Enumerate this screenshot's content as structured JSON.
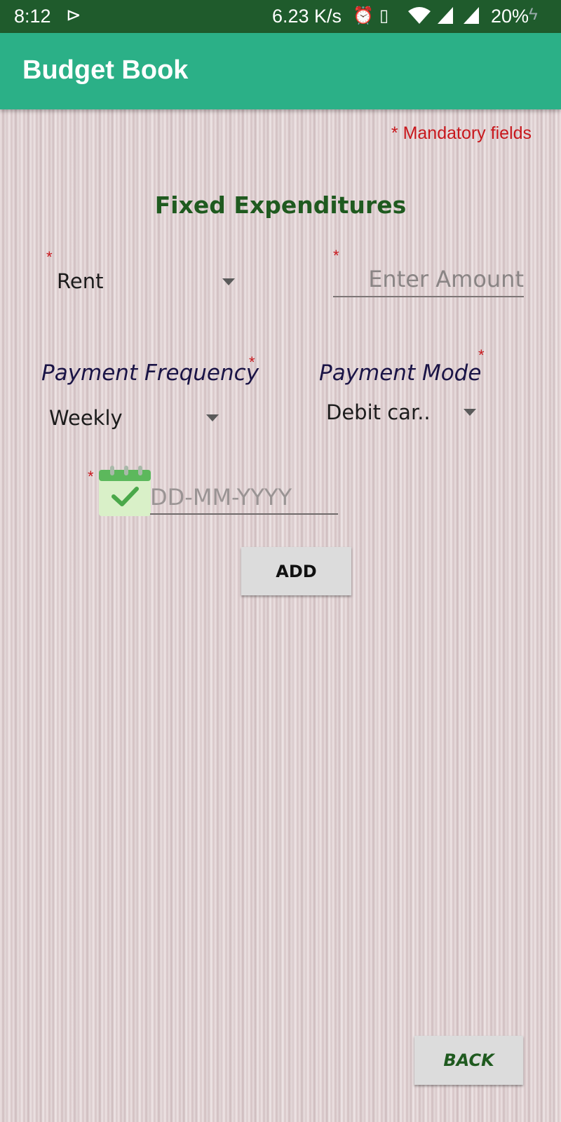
{
  "status_bar": {
    "time": "8:12",
    "net_speed": "6.23 K/s",
    "battery": "20%",
    "icons": [
      "play-store-notification-icon",
      "alarm-icon",
      "vibrate-icon",
      "wifi-icon",
      "signal-icon",
      "battery-charging-icon"
    ]
  },
  "app_bar": {
    "title": "Budget Book",
    "color": "#2bb087"
  },
  "form": {
    "mandatory_note": "* Mandatory fields",
    "section_title": "Fixed Expenditures",
    "required_marker": "*",
    "category": {
      "value": "Rent"
    },
    "amount": {
      "placeholder": "Enter Amount",
      "value": ""
    },
    "payment_frequency": {
      "label": "Payment Frequency",
      "value": "Weekly"
    },
    "payment_mode": {
      "label": "Payment Mode",
      "value": "Debit car.."
    },
    "date": {
      "placeholder": "DD-MM-YYYY",
      "value": ""
    },
    "add_label": "ADD"
  },
  "footer": {
    "back_label": "BACK"
  }
}
